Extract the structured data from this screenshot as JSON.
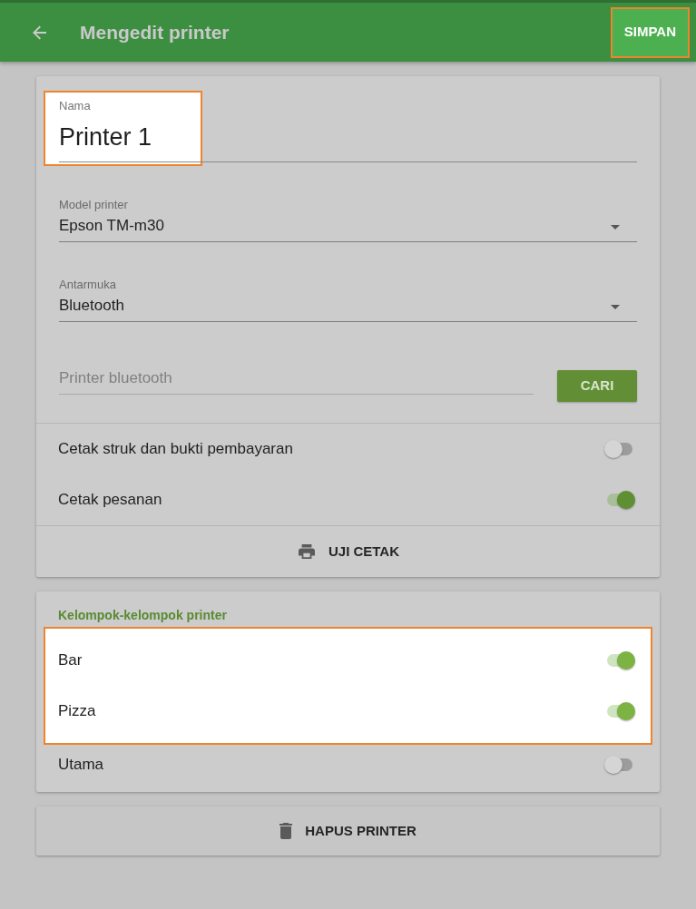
{
  "app_bar": {
    "title": "Mengedit printer",
    "save_button": {
      "label": "SIMPAN",
      "highlighted": true
    }
  },
  "printer_card": {
    "fields": [
      {
        "kind": "text",
        "label": "Nama",
        "value": "Printer 1",
        "highlighted": true
      },
      {
        "kind": "dropdown",
        "label": "Model printer",
        "value": "Epson TM-m30",
        "highlighted": false
      },
      {
        "kind": "dropdown",
        "label": "Antarmuka",
        "value": "Bluetooth",
        "highlighted": false
      },
      {
        "kind": "search",
        "placeholder": "Printer bluetooth",
        "button": "CARI",
        "highlighted": false
      }
    ],
    "switches": [
      {
        "label": "Cetak struk dan bukti pembayaran",
        "on": false
      },
      {
        "label": "Cetak pesanan",
        "on": true
      }
    ],
    "test_button": "UJI CETAK"
  },
  "groups_card": {
    "title": "Kelompok-kelompok printer",
    "items": [
      {
        "label": "Bar",
        "on": true,
        "highlighted": true
      },
      {
        "label": "Pizza",
        "on": true,
        "highlighted": true
      },
      {
        "label": "Utama",
        "on": false,
        "highlighted": false
      }
    ]
  },
  "delete_button": "HAPUS PRINTER"
}
